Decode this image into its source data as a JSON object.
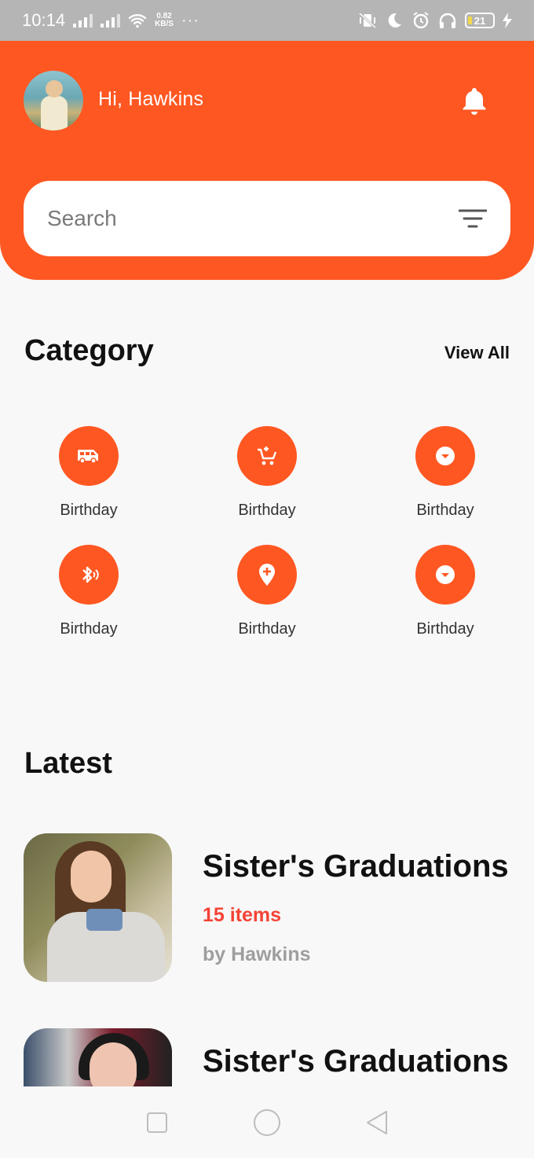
{
  "status_bar": {
    "time": "10:14",
    "net_speed_value": "0.82",
    "net_speed_unit": "KB/S",
    "more": "···",
    "battery": "21"
  },
  "header": {
    "greeting": "Hi, Hawkins",
    "accent_color": "#ff5722"
  },
  "search": {
    "placeholder": "Search"
  },
  "category": {
    "title": "Category",
    "view_all": "View All",
    "items": [
      {
        "label": "Birthday",
        "icon": "van-icon"
      },
      {
        "label": "Birthday",
        "icon": "add-to-cart-icon"
      },
      {
        "label": "Birthday",
        "icon": "dropdown-circle-icon"
      },
      {
        "label": "Birthday",
        "icon": "bluetooth-audio-icon"
      },
      {
        "label": "Birthday",
        "icon": "add-location-icon"
      },
      {
        "label": "Birthday",
        "icon": "dropdown-circle-icon"
      }
    ]
  },
  "latest": {
    "title": "Latest",
    "items": [
      {
        "title": "Sister's Graduations",
        "count": "15 items",
        "author": "by Hawkins"
      },
      {
        "title": "Sister's Graduations"
      }
    ]
  },
  "colors": {
    "accent": "#ff5722",
    "count_text": "#f44336",
    "author_text": "#9e9e9e"
  }
}
